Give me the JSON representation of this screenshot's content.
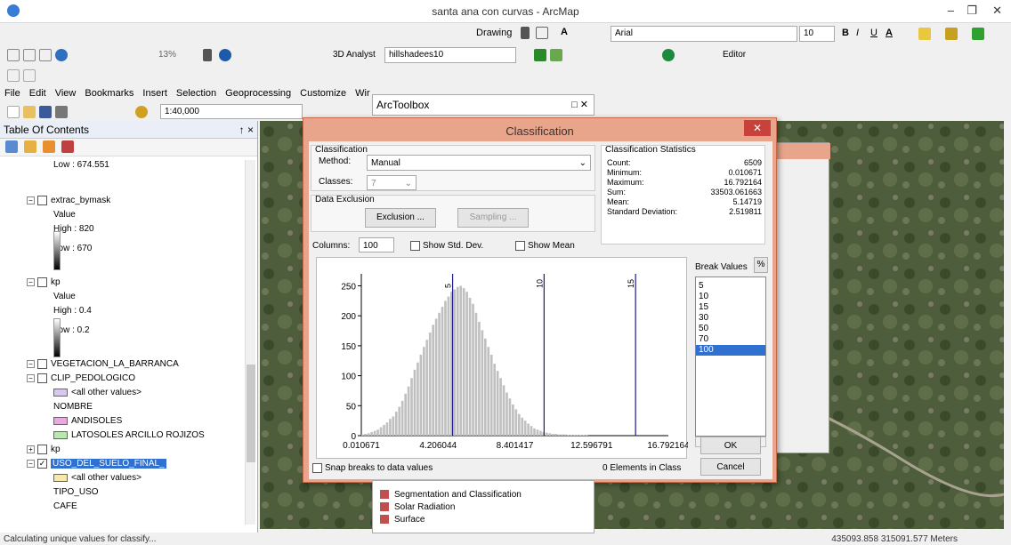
{
  "window": {
    "title": "santa ana con curvas - ArcMap"
  },
  "toolbar": {
    "drawing_label": "Drawing",
    "font_name": "Arial",
    "font_size": "10",
    "bold": "B",
    "italic": "I",
    "underline": "U",
    "font_color": "A",
    "zoom_pct": "13%",
    "analyst_label": "3D Analyst",
    "layer_select": "hillshadees10",
    "editor_label": "Editor",
    "scale": "1:40,000",
    "arctoolbox": "ArcToolbox"
  },
  "menu": [
    "File",
    "Edit",
    "View",
    "Bookmarks",
    "Insert",
    "Selection",
    "Geoprocessing",
    "Customize",
    "Wir"
  ],
  "toc": {
    "title": "Table Of Contents",
    "pin": "↑ ×",
    "items": [
      {
        "text": "Low : 674.551",
        "indent": 2
      },
      {
        "text": "extrac_bymask",
        "indent": 1,
        "layer": true,
        "checked": false
      },
      {
        "text": "Value",
        "indent": 2
      },
      {
        "text": "High : 820",
        "indent": 2
      },
      {
        "text": "Low : 670",
        "indent": 2
      },
      {
        "text": "kp",
        "indent": 1,
        "layer": true,
        "checked": false
      },
      {
        "text": "Value",
        "indent": 2
      },
      {
        "text": "High : 0.4",
        "indent": 2
      },
      {
        "text": "Low : 0.2",
        "indent": 2
      },
      {
        "text": "VEGETACION_LA_BARRANCA",
        "indent": 1,
        "layer": true,
        "checked": false
      },
      {
        "text": "CLIP_PEDOLOGICO",
        "indent": 1,
        "layer": true,
        "checked": false
      },
      {
        "text": "<all other values>",
        "indent": 2,
        "swatch": "#d8c8f0"
      },
      {
        "text": "NOMBRE",
        "indent": 2
      },
      {
        "text": "ANDISOLES",
        "indent": 2,
        "swatch": "#e8a8e0"
      },
      {
        "text": "LATOSOLES ARCILLO ROJIZOS",
        "indent": 2,
        "swatch": "#b8e8b0"
      },
      {
        "text": "kp",
        "indent": 1,
        "layer": true,
        "checked": false,
        "collapsed": true
      },
      {
        "text": "USO_DEL_SUELO_FINAL_",
        "indent": 1,
        "layer": true,
        "checked": true,
        "selected": true
      },
      {
        "text": "<all other values>",
        "indent": 2,
        "swatch": "#f8e8b0"
      },
      {
        "text": "TIPO_USO",
        "indent": 2
      },
      {
        "text": "CAFE",
        "indent": 2
      }
    ]
  },
  "dialog": {
    "title": "Classification",
    "classification_group": "Classification",
    "method_label": "Method:",
    "method_value": "Manual",
    "classes_label": "Classes:",
    "classes_value": "7",
    "exclusion_group": "Data Exclusion",
    "exclusion_btn": "Exclusion ...",
    "sampling_btn": "Sampling ...",
    "stats_group": "Classification Statistics",
    "stats": [
      {
        "label": "Count:",
        "value": "6509"
      },
      {
        "label": "Minimum:",
        "value": "0.010671"
      },
      {
        "label": "Maximum:",
        "value": "16.792164"
      },
      {
        "label": "Sum:",
        "value": "33503.061663"
      },
      {
        "label": "Mean:",
        "value": "5.14719"
      },
      {
        "label": "Standard Deviation:",
        "value": "2.519811"
      }
    ],
    "columns_label": "Columns:",
    "columns_value": "100",
    "show_std": "Show Std. Dev.",
    "show_mean": "Show Mean",
    "break_values_label": "Break Values",
    "pct_btn": "%",
    "break_values": [
      "5",
      "10",
      "15",
      "30",
      "50",
      "70",
      "100"
    ],
    "selected_break": "100",
    "snap_label": "Snap breaks to data values",
    "elements_in_class": "0 Elements in Class",
    "ok": "OK",
    "cancel": "Cancel"
  },
  "chart_data": {
    "type": "bar",
    "yticks": [
      "250",
      "200",
      "150",
      "100",
      "50",
      "0"
    ],
    "ylim": [
      0,
      270
    ],
    "xticks": [
      "0.010671",
      "4.206044",
      "8.401417",
      "12.596791",
      "16.792164"
    ],
    "xlim": [
      0.010671,
      16.792164
    ],
    "break_lines": [
      {
        "x": 5,
        "label": "5"
      },
      {
        "x": 10,
        "label": "10"
      },
      {
        "x": 15,
        "label": "15"
      }
    ],
    "bins": 100,
    "values": [
      2,
      3,
      4,
      6,
      8,
      10,
      14,
      18,
      22,
      28,
      32,
      40,
      48,
      58,
      70,
      82,
      96,
      110,
      122,
      135,
      148,
      160,
      172,
      185,
      195,
      205,
      215,
      225,
      232,
      240,
      244,
      248,
      250,
      246,
      240,
      230,
      220,
      205,
      190,
      176,
      162,
      148,
      135,
      120,
      108,
      96,
      84,
      72,
      62,
      52,
      44,
      36,
      30,
      25,
      20,
      16,
      12,
      10,
      8,
      6,
      5,
      4,
      3,
      3,
      2,
      2,
      2,
      1,
      1,
      1,
      1,
      1,
      1,
      1,
      0,
      0,
      0,
      0,
      0,
      0,
      0,
      0,
      0,
      0,
      0,
      0,
      0,
      0,
      0,
      0,
      0,
      0,
      0,
      0,
      0,
      0,
      0,
      0,
      0,
      0
    ]
  },
  "toolbox_items": [
    "Segmentation and Classification",
    "Solar Radiation",
    "Surface"
  ],
  "status": {
    "left": "Calculating unique values for classify...",
    "right": "435093.858  315091.577 Meters"
  }
}
